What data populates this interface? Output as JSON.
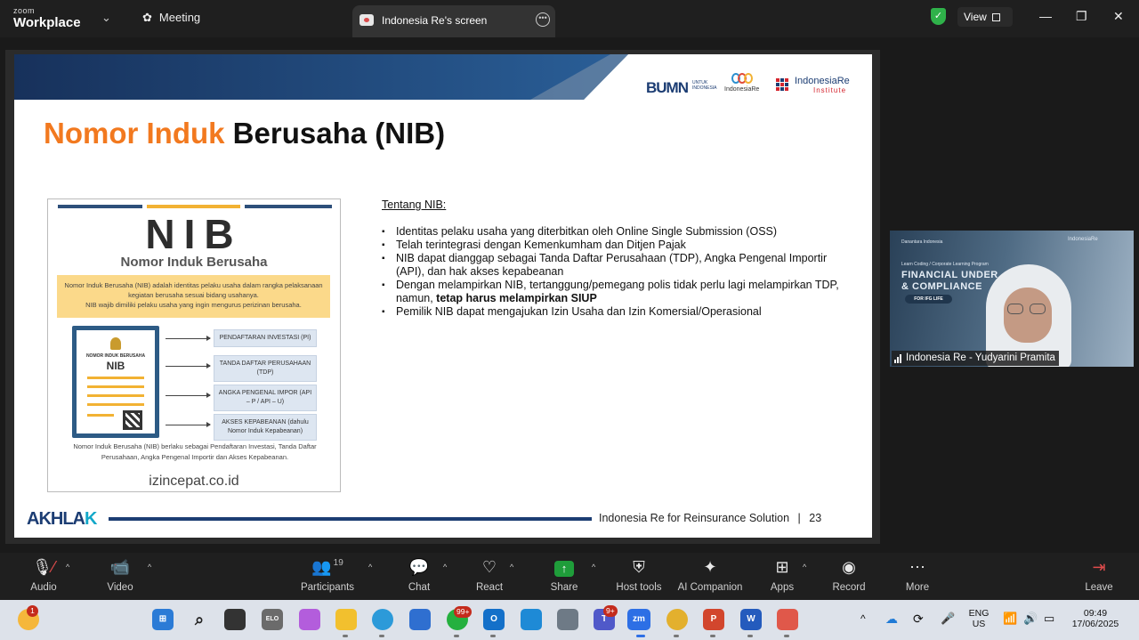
{
  "window": {
    "logo_top": "zoom",
    "logo_bottom": "Workplace",
    "meeting_tab": "Meeting",
    "screen_tab": "Indonesia Re's screen",
    "view_button": "View"
  },
  "slide": {
    "title_orange": "Nomor Induk",
    "title_black": "Berusaha (NIB)",
    "logos": {
      "bumn": "BUMN",
      "bumn_sub": "UNTUK INDONESIA",
      "indonesia_re": "IndonesiaRe",
      "iri_top": "IndonesiaRe",
      "iri_bottom": "Institute"
    },
    "image": {
      "big": "NIB",
      "subtitle": "Nomor Induk Berusaha",
      "yellow_line1": "Nomor Induk Berusaha (NIB) adalah identitas pelaku usaha dalam rangka pelaksanaan kegiatan berusaha sesuai bidang usahanya.",
      "yellow_line2": "NIB wajib dimiliki pelaku usaha yang ingin mengurus perizinan berusaha.",
      "doc_header": "NOMOR INDUK BERUSAHA",
      "doc_big": "NIB",
      "boxes": [
        "PENDAFTARAN INVESTASI (PI)",
        "TANDA DAFTAR PERUSAHAAN (TDP)",
        "ANGKA PENGENAL IMPOR (API – P / API – U)",
        "AKSES KEPABEANAN (dahulu Nomor Induk Kepabeanan)"
      ],
      "footer": "Nomor Induk Berusaha (NIB) berlaku sebagai Pendaftaran Investasi, Tanda Daftar Perusahaan, Angka Pengenal Importir dan Akses Kepabeanan.",
      "url": "izincepat.co.id"
    },
    "about_heading": "Tentang NIB:",
    "bullets": [
      "Identitas pelaku usaha yang diterbitkan oleh Online Single Submission (OSS)",
      "Telah terintegrasi dengan Kemenkumham dan Ditjen Pajak",
      "NIB dapat dianggap sebagai Tanda Daftar Perusahaan (TDP), Angka Pengenal Importir (API), dan hak akses kepabeanan",
      "Pemilik NIB dapat mengajukan Izin Usaha dan Izin Komersial/Operasional"
    ],
    "bullet4_plain": "Dengan melampirkan NIB, tertanggung/pemegang polis tidak perlu lagi melampirkan TDP, namun, ",
    "bullet4_bold": "tetap harus melampirkan SIUP",
    "footer_logo_a": "AKHLA",
    "footer_logo_b": "K",
    "footer_text": "Indonesia Re for Reinsurance Solution",
    "page_number": "23"
  },
  "video": {
    "participant_name": "Indonesia Re - Yudyarini Pramita",
    "banner_small": "Learn Coding / Corporate Learning Program",
    "banner_line1": "FINANCIAL UNDER",
    "banner_line2": "& COMPLIANCE",
    "banner_pill": "FOR IFG LIFE",
    "logo_left": "Danantara Indonesia",
    "logo_right": "IndonesiaRe"
  },
  "toolbar": {
    "audio": "Audio",
    "video": "Video",
    "participants": "Participants",
    "participants_count": "19",
    "chat": "Chat",
    "react": "React",
    "share": "Share",
    "host_tools": "Host tools",
    "ai_companion": "AI Companion",
    "apps": "Apps",
    "record": "Record",
    "more": "More",
    "leave": "Leave"
  },
  "taskbar": {
    "weather_badge": "1",
    "whatsapp_badge": "99+",
    "teams_badge": "9+",
    "language": "ENG",
    "region": "US",
    "time": "09:49",
    "date": "17/06/2025"
  }
}
